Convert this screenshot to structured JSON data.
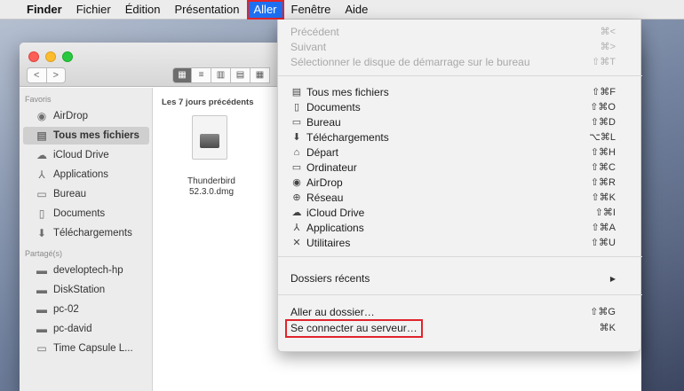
{
  "menubar": {
    "apple": "",
    "items": [
      "Finder",
      "Fichier",
      "Édition",
      "Présentation",
      "Aller",
      "Fenêtre",
      "Aide"
    ]
  },
  "window": {
    "nav": {
      "back": "<",
      "forward": ">"
    },
    "view_buttons": [
      "▦",
      "≡",
      "▥",
      "▤",
      "▦"
    ],
    "sidebar": {
      "favorites_label": "Favoris",
      "favorites": [
        "AirDrop",
        "Tous mes fichiers",
        "iCloud Drive",
        "Applications",
        "Bureau",
        "Documents",
        "Téléchargements"
      ],
      "favorite_icons": [
        "airdrop-icon",
        "all-files-icon",
        "cloud-icon",
        "applications-icon",
        "desktop-icon",
        "documents-icon",
        "downloads-icon"
      ],
      "shared_label": "Partagé(s)",
      "shared": [
        "developtech-hp",
        "DiskStation",
        "pc-02",
        "pc-david",
        "Time Capsule L..."
      ]
    },
    "content": {
      "header": "Les 7 jours précédents",
      "file": {
        "name_line1": "Thunderbird",
        "name_line2": "52.3.0.dmg"
      }
    }
  },
  "go_menu": {
    "disabled": [
      {
        "label": "Précédent",
        "shortcut": "⌘<"
      },
      {
        "label": "Suivant",
        "shortcut": "⌘>"
      },
      {
        "label": "Sélectionner le disque de démarrage sur le bureau",
        "shortcut": "⇧⌘T"
      }
    ],
    "locations": [
      {
        "label": "Tous mes fichiers",
        "shortcut": "⇧⌘F",
        "icon": "all-files-icon"
      },
      {
        "label": "Documents",
        "shortcut": "⇧⌘O",
        "icon": "documents-icon"
      },
      {
        "label": "Bureau",
        "shortcut": "⇧⌘D",
        "icon": "desktop-icon"
      },
      {
        "label": "Téléchargements",
        "shortcut": "⌥⌘L",
        "icon": "downloads-icon"
      },
      {
        "label": "Départ",
        "shortcut": "⇧⌘H",
        "icon": "home-icon"
      },
      {
        "label": "Ordinateur",
        "shortcut": "⇧⌘C",
        "icon": "computer-icon"
      },
      {
        "label": "AirDrop",
        "shortcut": "⇧⌘R",
        "icon": "airdrop-icon"
      },
      {
        "label": "Réseau",
        "shortcut": "⇧⌘K",
        "icon": "network-icon"
      },
      {
        "label": "iCloud Drive",
        "shortcut": "⇧⌘I",
        "icon": "cloud-icon"
      },
      {
        "label": "Applications",
        "shortcut": "⇧⌘A",
        "icon": "applications-icon"
      },
      {
        "label": "Utilitaires",
        "shortcut": "⇧⌘U",
        "icon": "utilities-icon"
      }
    ],
    "recent": {
      "label": "Dossiers récents",
      "arrow": "▶"
    },
    "goto_folder": {
      "label": "Aller au dossier…",
      "shortcut": "⇧⌘G"
    },
    "connect_server": {
      "label": "Se connecter au serveur…",
      "shortcut": "⌘K"
    }
  },
  "colors": {
    "menu_highlight": "#1d6ff2",
    "annotation": "#e0242c"
  }
}
